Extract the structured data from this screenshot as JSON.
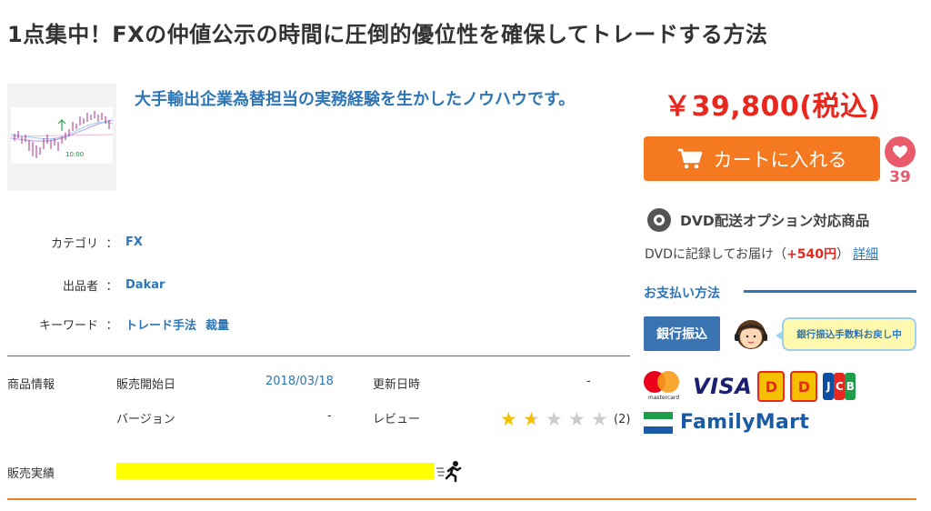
{
  "page_title": "1点集中！FXの仲値公示の時間に圧倒的優位性を確保してトレードする方法",
  "thumbnail": {
    "label": "10:00"
  },
  "catchcopy": "大手輸出企業為替担当の実務経験を生かしたノウハウです。",
  "meta": {
    "category": {
      "label": "カテゴリ",
      "colon": "：",
      "value": "FX"
    },
    "seller": {
      "label": "出品者",
      "colon": "：",
      "value": "Dakar"
    },
    "keywords": {
      "label": "キーワード",
      "colon": "：",
      "values": [
        "トレード手法",
        "裁量"
      ]
    }
  },
  "product_info": {
    "section_label": "商品情報",
    "release_label": "販売開始日",
    "release_value": "2018/03/18",
    "updated_label": "更新日時",
    "updated_value": "-",
    "version_label": "バージョン",
    "version_value": "-",
    "review_label": "レビュー",
    "review_rating": 1.5,
    "review_max": 5,
    "review_count": "(2)"
  },
  "sales": {
    "label": "販売実績"
  },
  "price": "￥39,800(税込)",
  "cart_button": "カートに入れる",
  "favorite": {
    "count": "39"
  },
  "dvd": {
    "title": "DVD配送オプション対応商品",
    "note_prefix": "DVDに記録してお届け（",
    "note_price": "+540円",
    "note_suffix": "）",
    "detail_link": "詳細"
  },
  "payment": {
    "heading": "お支払い方法",
    "bank_button": "銀行振込",
    "bubble": "銀行振込手数料お戻し中",
    "logos": {
      "mastercard": "mastercard",
      "visa": "VISA",
      "familymart": "FamilyMart",
      "jcb": [
        "J",
        "C",
        "B"
      ]
    }
  },
  "colors": {
    "accent_blue": "#2e75b6",
    "price_red": "#e8281e",
    "cart_orange": "#f47920",
    "favorite_pink": "#e95a6b"
  }
}
